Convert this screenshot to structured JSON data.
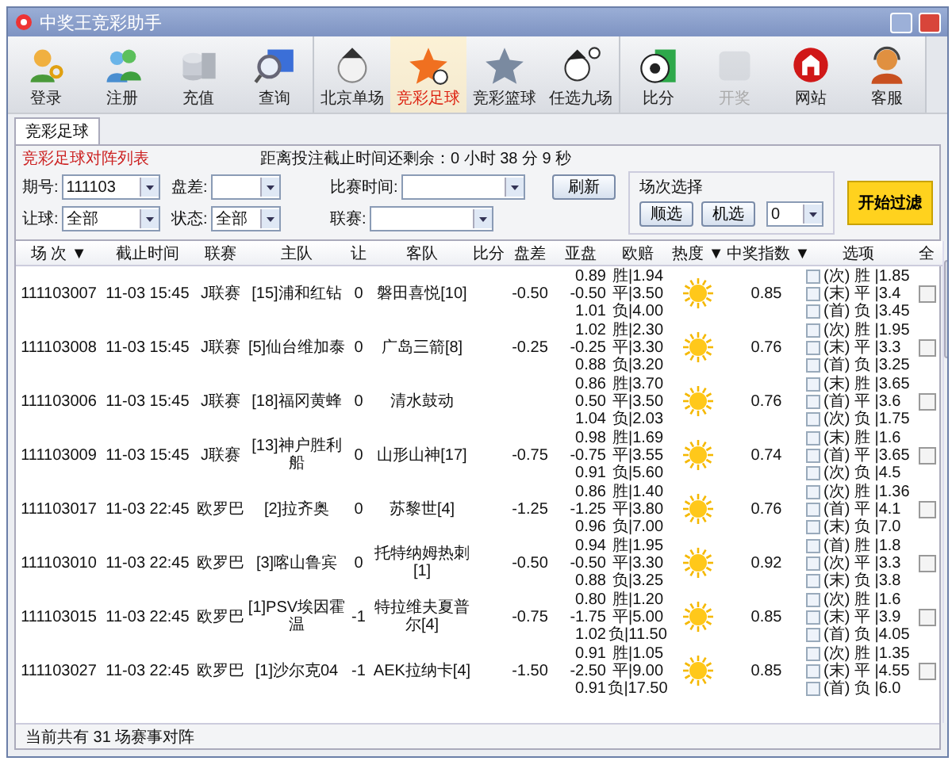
{
  "window": {
    "title": "中奖王竞彩助手"
  },
  "toolbar": {
    "groups": [
      [
        {
          "label": "登录",
          "selected": false,
          "disabled": false
        },
        {
          "label": "注册",
          "selected": false,
          "disabled": false
        },
        {
          "label": "充值",
          "selected": false,
          "disabled": false
        },
        {
          "label": "查询",
          "selected": false,
          "disabled": false
        }
      ],
      [
        {
          "label": "北京单场",
          "selected": false,
          "disabled": false
        },
        {
          "label": "竞彩足球",
          "selected": true,
          "disabled": false
        },
        {
          "label": "竞彩篮球",
          "selected": false,
          "disabled": false
        },
        {
          "label": "任选九场",
          "selected": false,
          "disabled": false
        }
      ],
      [
        {
          "label": "比分",
          "selected": false,
          "disabled": false
        },
        {
          "label": "开奖",
          "selected": false,
          "disabled": true
        },
        {
          "label": "网站",
          "selected": false,
          "disabled": false
        },
        {
          "label": "客服",
          "selected": false,
          "disabled": false
        }
      ]
    ]
  },
  "tabs": [
    {
      "label": "竞彩足球",
      "selected": true
    }
  ],
  "panel": {
    "title": "竞彩足球对阵列表",
    "countdown": "距离投注截止时间还剩余：0 小时 38 分 9 秒"
  },
  "filters": [
    [
      {
        "label": "期号:",
        "value": "111103"
      },
      {
        "label": "盘差:"
      },
      {
        "label": "比赛时间:"
      }
    ],
    [
      {
        "label": "让球:",
        "value": "全部"
      },
      {
        "label": "状态:",
        "value": "全部"
      },
      {
        "label": "联赛:"
      }
    ]
  ],
  "refresh_button": "刷新",
  "selection": {
    "title": "场次选择",
    "buttons": [
      "顺选",
      "机选"
    ],
    "count": "0",
    "start_button": "开始过滤"
  },
  "table": {
    "columns": [
      {
        "label": "场 次",
        "arrow": "▼"
      },
      {
        "label": "截止时间"
      },
      {
        "label": "联赛"
      },
      {
        "label": "主队"
      },
      {
        "label": "让"
      },
      {
        "label": "客队"
      },
      {
        "label": "比分"
      },
      {
        "label": "盘差"
      },
      {
        "label": "亚盘"
      },
      {
        "label": "欧赔"
      },
      {
        "label": "热度",
        "arrow": "▼"
      },
      {
        "label": "中奖指数",
        "arrow": "▼"
      },
      {
        "label": "选项"
      },
      {
        "label": "全"
      }
    ],
    "rows": [
      {
        "id": "111103007",
        "time": "11-03 15:45",
        "league": "J联赛",
        "home": "[15]浦和红钻",
        "handicap": "0",
        "away": "磐田喜悦[10]",
        "diff": "-0.50",
        "asian": [
          "0.89",
          "-0.50",
          "1.01"
        ],
        "euro": [
          "胜|1.94",
          "平|3.50",
          "负|4.00"
        ],
        "index": "0.85",
        "options": [
          {
            "text": "(次) 胜 |1.85",
            "checked": false
          },
          {
            "text": "(末) 平 |3.4",
            "checked": false
          },
          {
            "text": "(首) 负 |3.45",
            "checked": false
          }
        ],
        "checked": false
      },
      {
        "id": "111103008",
        "time": "11-03 15:45",
        "league": "J联赛",
        "home": "[5]仙台维加泰",
        "handicap": "0",
        "away": "广岛三箭[8]",
        "diff": "-0.25",
        "asian": [
          "1.02",
          "-0.25",
          "0.88"
        ],
        "euro": [
          "胜|2.30",
          "平|3.30",
          "负|3.20"
        ],
        "index": "0.76",
        "options": [
          {
            "text": "(次) 胜 |1.95",
            "checked": false
          },
          {
            "text": "(末) 平 |3.3",
            "checked": false
          },
          {
            "text": "(首) 负 |3.25",
            "checked": false
          }
        ],
        "checked": false
      },
      {
        "id": "111103006",
        "time": "11-03 15:45",
        "league": "J联赛",
        "home": "[18]福冈黄蜂",
        "handicap": "0",
        "away": "清水鼓动",
        "asian": [
          "0.86",
          "0.50",
          "1.04"
        ],
        "euro": [
          "胜|3.70",
          "平|3.50",
          "负|2.03"
        ],
        "index": "0.76",
        "options": [
          {
            "text": "(末) 胜 |3.65",
            "checked": false
          },
          {
            "text": "(首) 平 |3.6",
            "checked": false
          },
          {
            "text": "(次) 负 |1.75",
            "checked": false
          }
        ],
        "checked": false
      },
      {
        "id": "111103009",
        "time": "11-03 15:45",
        "league": "J联赛",
        "home": "[13]神户胜利船",
        "handicap": "0",
        "away": "山形山神[17]",
        "diff": "-0.75",
        "asian": [
          "0.98",
          "-0.75",
          "0.91"
        ],
        "euro": [
          "胜|1.69",
          "平|3.55",
          "负|5.60"
        ],
        "index": "0.74",
        "options": [
          {
            "text": "(末) 胜 |1.6",
            "checked": false
          },
          {
            "text": "(首) 平 |3.65",
            "checked": false
          },
          {
            "text": "(次) 负 |4.5",
            "checked": false
          }
        ],
        "checked": false
      },
      {
        "id": "111103017",
        "time": "11-03 22:45",
        "league": "欧罗巴",
        "home": "[2]拉齐奥",
        "handicap": "0",
        "away": "苏黎世[4]",
        "diff": "-1.25",
        "asian": [
          "0.86",
          "-1.25",
          "0.96"
        ],
        "euro": [
          "胜|1.40",
          "平|3.80",
          "负|7.00"
        ],
        "index": "0.76",
        "options": [
          {
            "text": "(次) 胜 |1.36",
            "checked": false
          },
          {
            "text": "(首) 平 |4.1",
            "checked": false
          },
          {
            "text": "(末) 负 |7.0",
            "checked": false
          }
        ],
        "checked": false
      },
      {
        "id": "111103010",
        "time": "11-03 22:45",
        "league": "欧罗巴",
        "home": "[3]喀山鲁宾",
        "handicap": "0",
        "away": "托特纳姆热刺[1]",
        "diff": "-0.50",
        "asian": [
          "0.94",
          "-0.50",
          "0.88"
        ],
        "euro": [
          "胜|1.95",
          "平|3.30",
          "负|3.25"
        ],
        "index": "0.92",
        "options": [
          {
            "text": "(首) 胜 |1.8",
            "checked": false
          },
          {
            "text": "(次) 平 |3.3",
            "checked": false
          },
          {
            "text": "(末) 负 |3.8",
            "checked": false
          }
        ],
        "checked": false
      },
      {
        "id": "111103015",
        "time": "11-03 22:45",
        "league": "欧罗巴",
        "home": "[1]PSV埃因霍温",
        "handicap": "-1",
        "away": "特拉维夫夏普尔[4]",
        "diff": "-0.75",
        "asian": [
          "0.80",
          "-1.75",
          "1.02"
        ],
        "euro": [
          "胜|1.20",
          "平|5.00",
          "负|11.50"
        ],
        "index": "0.85",
        "options": [
          {
            "text": "(次) 胜 |1.6",
            "checked": false
          },
          {
            "text": "(末) 平 |3.9",
            "checked": false
          },
          {
            "text": "(首) 负 |4.05",
            "checked": false
          }
        ],
        "checked": false
      },
      {
        "id": "111103027",
        "time": "11-03 22:45",
        "league": "欧罗巴",
        "home": "[1]沙尔克04",
        "handicap": "-1",
        "away": "AEK拉纳卡[4]",
        "diff": "-1.50",
        "asian": [
          "0.91",
          "-2.50",
          "0.91"
        ],
        "euro": [
          "胜|1.05",
          "平|9.00",
          "负|17.50"
        ],
        "index": "0.85",
        "options": [
          {
            "text": "(次) 胜 |1.35",
            "checked": false
          },
          {
            "text": "(末) 平 |4.55",
            "checked": false
          },
          {
            "text": "(首) 负 |6.0",
            "checked": false
          }
        ],
        "checked": false
      }
    ]
  },
  "status_bar": "当前共有 31 场赛事对阵"
}
